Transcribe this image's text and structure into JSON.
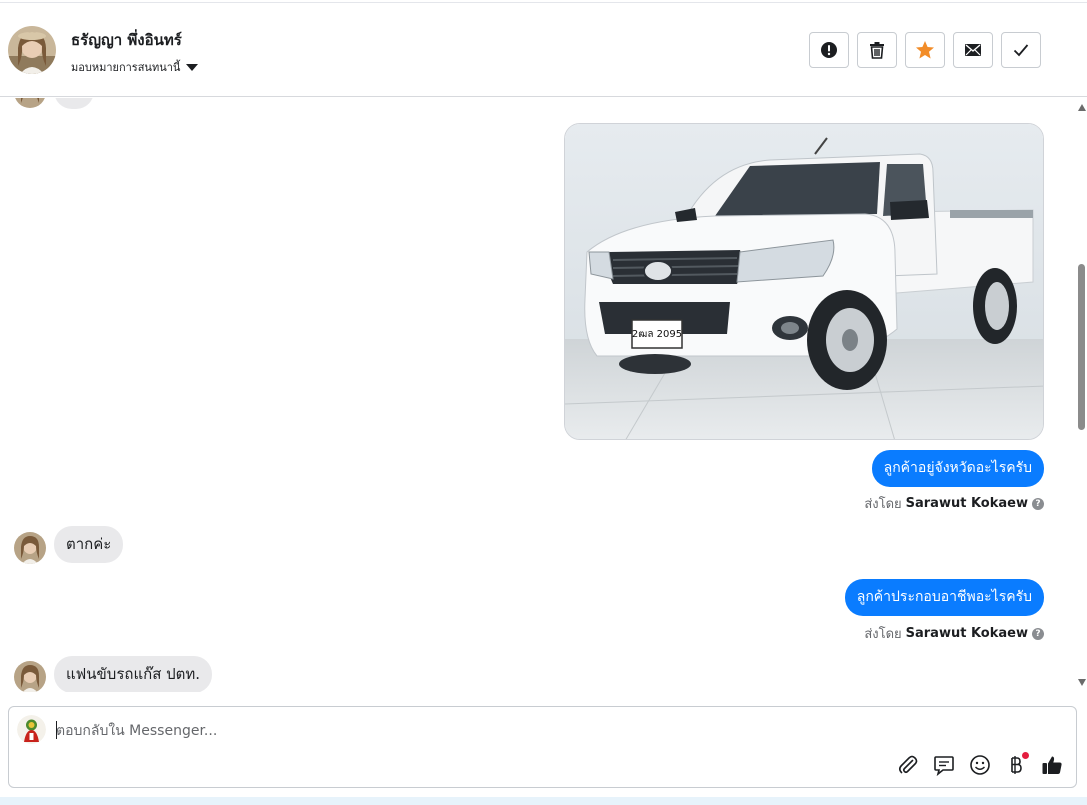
{
  "header": {
    "contact_name": "ธรัญญา พึ่งอินทร์",
    "assign_label": "มอบหมายการสนทนานี้",
    "actions": [
      {
        "name": "spam-button",
        "icon": "exclamation-icon"
      },
      {
        "name": "delete-button",
        "icon": "trash-icon"
      },
      {
        "name": "star-button",
        "icon": "star-icon",
        "color": "#f28c28"
      },
      {
        "name": "mark-unread-button",
        "icon": "envelope-icon"
      },
      {
        "name": "mark-done-button",
        "icon": "check-icon"
      }
    ]
  },
  "conversation": {
    "photo_plate": "2ฒล 2095",
    "messages": [
      {
        "direction": "out",
        "text": "ลูกค้าอยู่จังหวัดอะไรครับ"
      },
      {
        "direction": "meta",
        "prefix": "ส่งโดย",
        "sender": "Sarawut Kokaew"
      },
      {
        "direction": "in",
        "text": "ตากค่ะ"
      },
      {
        "direction": "out",
        "text": "ลูกค้าประกอบอาชีพอะไรครับ"
      },
      {
        "direction": "meta",
        "prefix": "ส่งโดย",
        "sender": "Sarawut Kokaew"
      },
      {
        "direction": "in",
        "text": "แฟนขับรถแก๊ส ปตท."
      }
    ]
  },
  "composer": {
    "placeholder": "ตอบกลับใน Messenger...",
    "tools": [
      "attach-icon",
      "saved-reply-icon",
      "emoji-icon",
      "baht-payment-icon",
      "like-icon"
    ]
  },
  "colors": {
    "accent": "#0a7cff",
    "incoming_bubble": "#e9e9eb",
    "star": "#f28c28",
    "notification_dot": "#e41e3f"
  }
}
